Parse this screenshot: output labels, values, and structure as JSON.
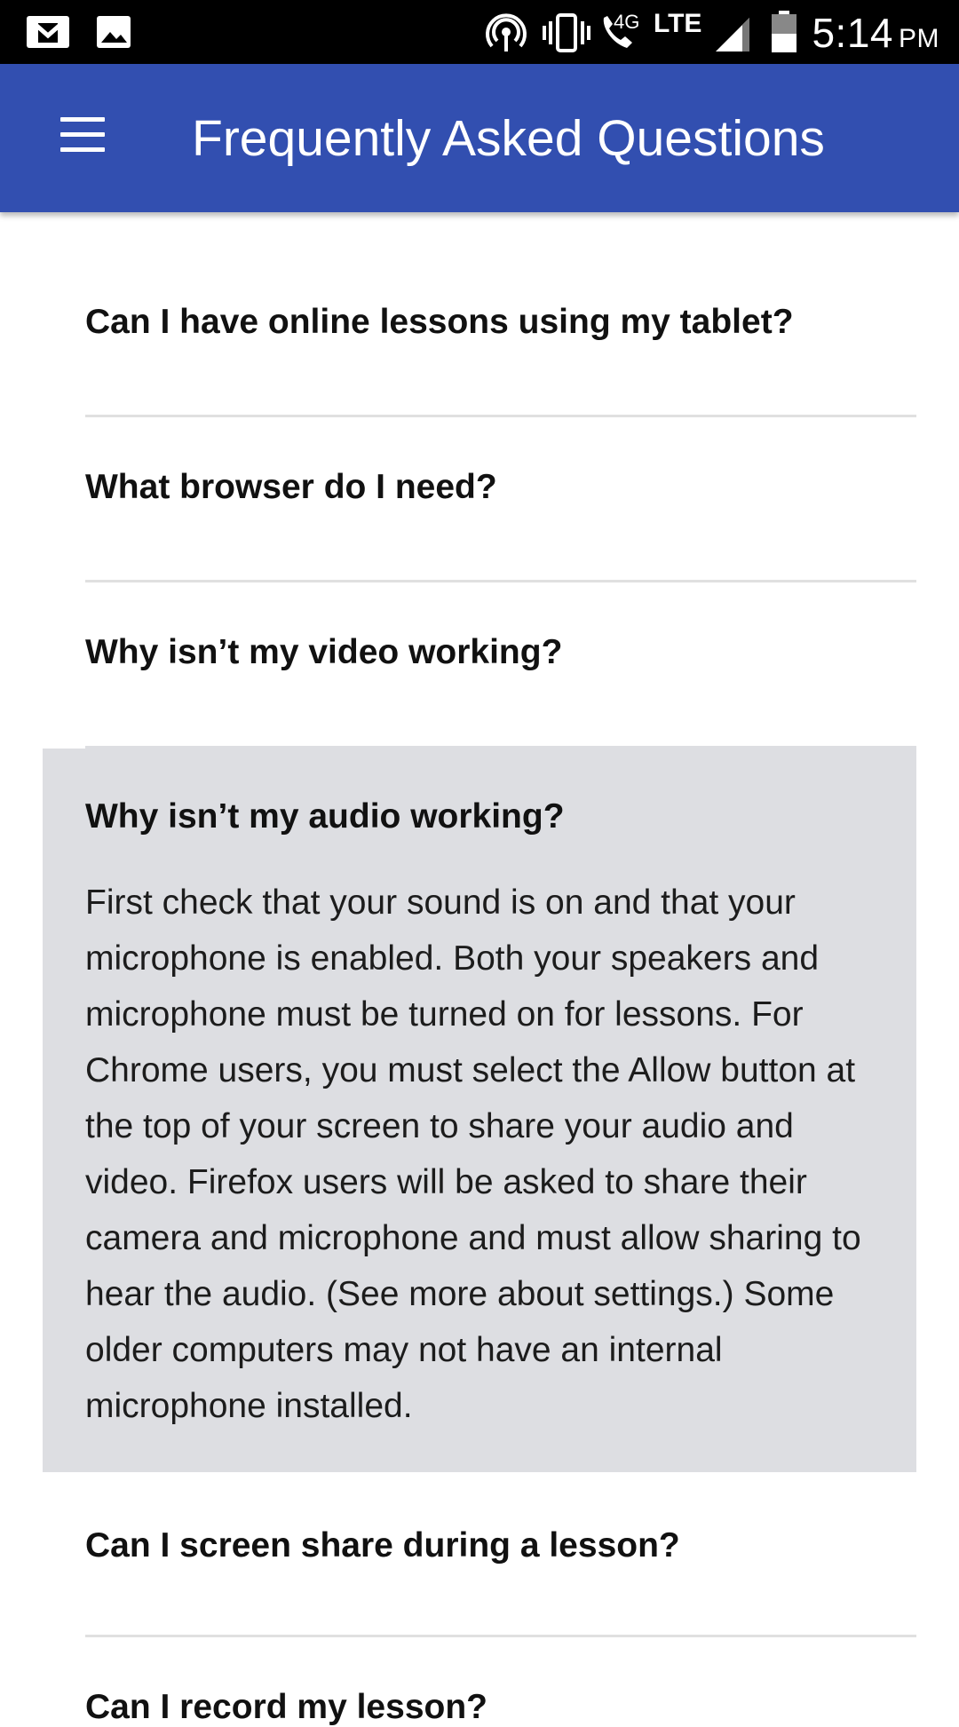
{
  "status_bar": {
    "time": "5:14",
    "ampm": "PM",
    "network_type": "LTE",
    "network_gen": "4G",
    "icons": [
      "gmail-icon",
      "image-icon",
      "hotspot-icon",
      "vibrate-icon",
      "wifi-calling-icon",
      "signal-icon",
      "battery-icon"
    ]
  },
  "app_bar": {
    "title": "Frequently Asked Questions",
    "menu_icon": "hamburger-menu-icon",
    "background": "#324fb0"
  },
  "faqs": [
    {
      "question": "Can I have online lessons using my tablet?",
      "expanded": false
    },
    {
      "question": "What browser do I need?",
      "expanded": false
    },
    {
      "question": "Why isn’t my video working?",
      "expanded": false
    },
    {
      "question": "Why isn’t my audio working?",
      "expanded": true,
      "answer": "First check that your sound is on and that your microphone is enabled. Both your speakers and microphone must be turned on for lessons. For Chrome users, you must select the Allow button at the top of your screen to share your audio and video. Firefox users will be asked to share their camera and microphone and must allow sharing to hear the audio. (See more about settings.) Some older computers may not have an internal microphone installed."
    },
    {
      "question": "Can I screen share during a lesson?",
      "expanded": false
    },
    {
      "question": "Can I record my lesson?",
      "expanded": false
    }
  ],
  "colors": {
    "expanded_background": "#dddee2",
    "divider": "#e0e0e0"
  }
}
